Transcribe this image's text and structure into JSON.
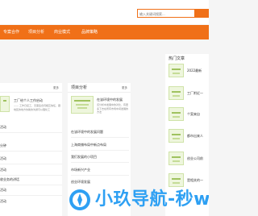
{
  "search": {
    "placeholder": "输入关键词搜索..."
  },
  "nav": {
    "items": [
      "专案合作",
      "项目分析",
      "商业模式",
      "品牌策略"
    ]
  },
  "breadcrumb": "",
  "left_card": {
    "more": "更多",
    "feature_title": "工厂给个人工作启动",
    "feature_desc": "—— 工作日接工，无需签合同相互信任，跟地区的地方协助的沟通可以理化工",
    "list": [
      "活动",
      "分钟",
      "活动",
      "活动",
      "收业务的讲话",
      "活动",
      "活动"
    ]
  },
  "mid_card": {
    "title": "项目分析",
    "more": "更多",
    "feature_title": "在该环境中的发展",
    "feature_desc": "该分析中发展中的对比，有更多下去在所有市场中间发展的方法",
    "list": [
      "在该环境中的发展问题",
      "上海商铺布局中新点布局",
      "我们发展的小项目",
      "市场新兴产业",
      "创业环境发展"
    ]
  },
  "right_card": {
    "title": "热门文章",
    "items": [
      "2022最新",
      "工厂附近一",
      "个案来自",
      "都市出来人",
      "创业公司前",
      "是相关的一"
    ]
  },
  "watermark": {
    "text": "小玖导航-秒w"
  },
  "colors": {
    "accent": "#f07018",
    "watermark": "#2ea0f3"
  }
}
